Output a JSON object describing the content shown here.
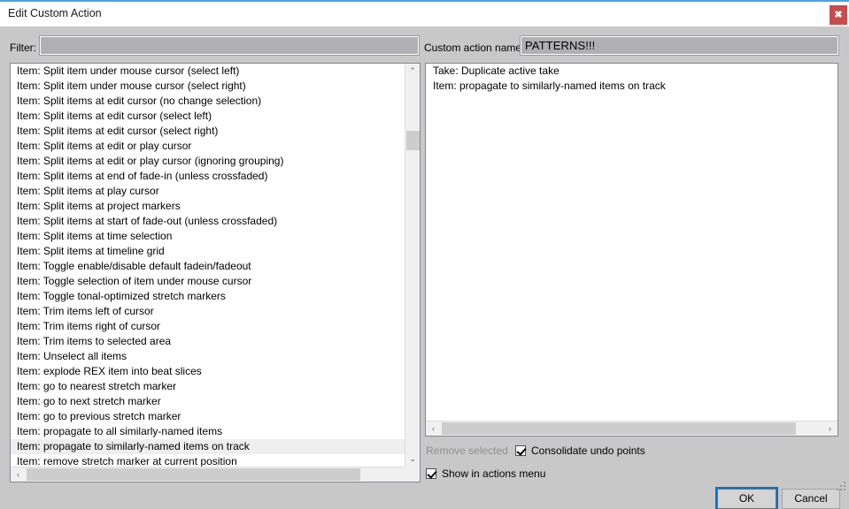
{
  "window": {
    "title": "Edit Custom Action",
    "close_icon": "close-icon",
    "close_glyph": "✖",
    "accent_color": "#4aa3e0",
    "close_button_color": "#c84c4c",
    "body_color": "#c8c8c8"
  },
  "filter": {
    "label": "Filter:",
    "value": "",
    "placeholder": ""
  },
  "action_name": {
    "label": "Custom action name:",
    "value": "PATTERNS!!!",
    "placeholder": ""
  },
  "actions_list": {
    "items": [
      "Item: Split item under mouse cursor (select left)",
      "Item: Split item under mouse cursor (select right)",
      "Item: Split items at edit cursor (no change selection)",
      "Item: Split items at edit cursor (select left)",
      "Item: Split items at edit cursor (select right)",
      "Item: Split items at edit or play cursor",
      "Item: Split items at edit or play cursor (ignoring grouping)",
      "Item: Split items at end of fade-in (unless crossfaded)",
      "Item: Split items at play cursor",
      "Item: Split items at project markers",
      "Item: Split items at start of fade-out (unless crossfaded)",
      "Item: Split items at time selection",
      "Item: Split items at timeline grid",
      "Item: Toggle enable/disable default fadein/fadeout",
      "Item: Toggle selection of item under mouse cursor",
      "Item: Toggle tonal-optimized stretch markers",
      "Item: Trim items left of cursor",
      "Item: Trim items right of cursor",
      "Item: Trim items to selected area",
      "Item: Unselect all items",
      "Item: explode REX item into beat slices",
      "Item: go to nearest stretch marker",
      "Item: go to next stretch marker",
      "Item: go to previous stretch marker",
      "Item: propagate to all similarly-named items",
      "Item: propagate to similarly-named items on track",
      "Item: remove stretch marker at current position"
    ],
    "selected_index": 25,
    "selection_color": "#eeeeee",
    "vscroll_up_icon": "chevron-up-icon",
    "vscroll_down_icon": "chevron-down-icon",
    "hscroll_left_icon": "chevron-left-icon",
    "hscroll_right_icon": "chevron-right-icon",
    "up_glyph": "⌃",
    "down_glyph": "⌄",
    "left_glyph": "‹",
    "right_glyph": "›"
  },
  "selected_actions": {
    "items": [
      "Take: Duplicate active take",
      "Item: propagate to similarly-named items on track"
    ],
    "hscroll_left_icon": "chevron-left-icon",
    "hscroll_right_icon": "chevron-right-icon",
    "left_glyph": "‹",
    "right_glyph": "›"
  },
  "controls": {
    "remove_selected_label": "Remove selected",
    "remove_selected_enabled": false,
    "consolidate_undo_label": "Consolidate undo points",
    "consolidate_undo_checked": true,
    "show_in_actions_menu_label": "Show in actions menu",
    "show_in_actions_menu_checked": true
  },
  "footer": {
    "ok_label": "OK",
    "cancel_label": "Cancel",
    "focus_color": "#0b71c4",
    "resize_grip_icon": "resize-grip-icon"
  }
}
